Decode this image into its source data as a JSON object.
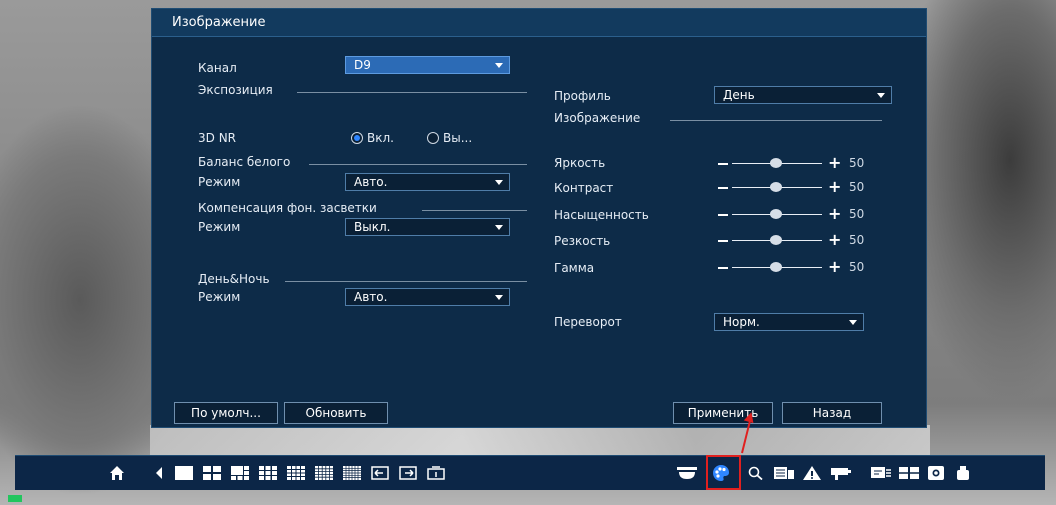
{
  "dialog": {
    "title": "Изображение",
    "channel": {
      "label": "Канал",
      "value": "D9"
    },
    "exposure": {
      "title": "Экспозиция"
    },
    "nr3d": {
      "label": "3D NR",
      "on_label": "Вкл.",
      "off_label": "Вы...",
      "selected": "on"
    },
    "white_balance": {
      "title": "Баланс белого",
      "mode_label": "Режим",
      "mode_value": "Авто."
    },
    "backlight": {
      "title": "Компенсация фон. засветки",
      "mode_label": "Режим",
      "mode_value": "Выкл."
    },
    "day_night": {
      "title": "День&Ночь",
      "mode_label": "Режим",
      "mode_value": "Авто."
    },
    "profile": {
      "label": "Профиль",
      "value": "День"
    },
    "image_section": {
      "title": "Изображение"
    },
    "sliders": [
      {
        "label": "Яркость",
        "value": "50"
      },
      {
        "label": "Контраст",
        "value": "50"
      },
      {
        "label": "Насыщенность",
        "value": "50"
      },
      {
        "label": "Резкость",
        "value": "50"
      },
      {
        "label": "Гамма",
        "value": "50"
      }
    ],
    "flip": {
      "label": "Переворот",
      "value": "Норм."
    },
    "buttons": {
      "default": "По умолч...",
      "refresh": "Обновить",
      "apply": "Применить",
      "back": "Назад"
    }
  },
  "colors": {
    "dialog_bg": "#0d2b48",
    "accent": "#2f86ff",
    "highlight": "#e0201f"
  }
}
